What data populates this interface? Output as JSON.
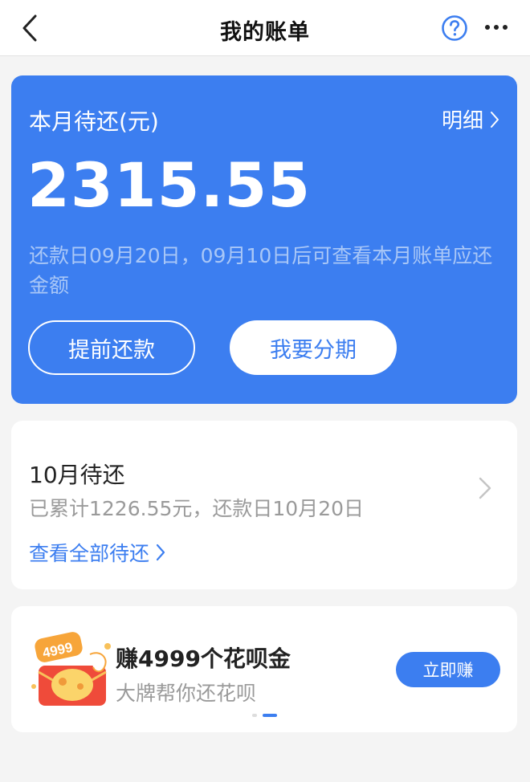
{
  "navbar": {
    "title": "我的账单",
    "icons": [
      "chevron-left-icon",
      "help-circle-icon",
      "more-icon"
    ]
  },
  "bill": {
    "label": "本月待还(元)",
    "detail_link": "明细",
    "amount": "2315.55",
    "note": "还款日09月20日，09月10日后可查看本月账单应还金额",
    "prepay_button": "提前还款",
    "installment_button": "我要分期"
  },
  "next_month": {
    "title": "10月待还",
    "summary": "已累计1226.55元，还款日10月20日",
    "view_all_link": "查看全部待还"
  },
  "promo": {
    "title": "赚4999个花呗金",
    "subtitle": "大牌帮你还花呗",
    "button": "立即赚",
    "illustration_text": "4999",
    "carousel": {
      "count": 2,
      "active_index": 1
    }
  },
  "colors": {
    "accent": "#3c7ef0",
    "page_bg": "#f4f4f4",
    "card_bg": "#ffffff",
    "muted_text": "#9a9a9a",
    "note_text": "#a9c7f7"
  }
}
